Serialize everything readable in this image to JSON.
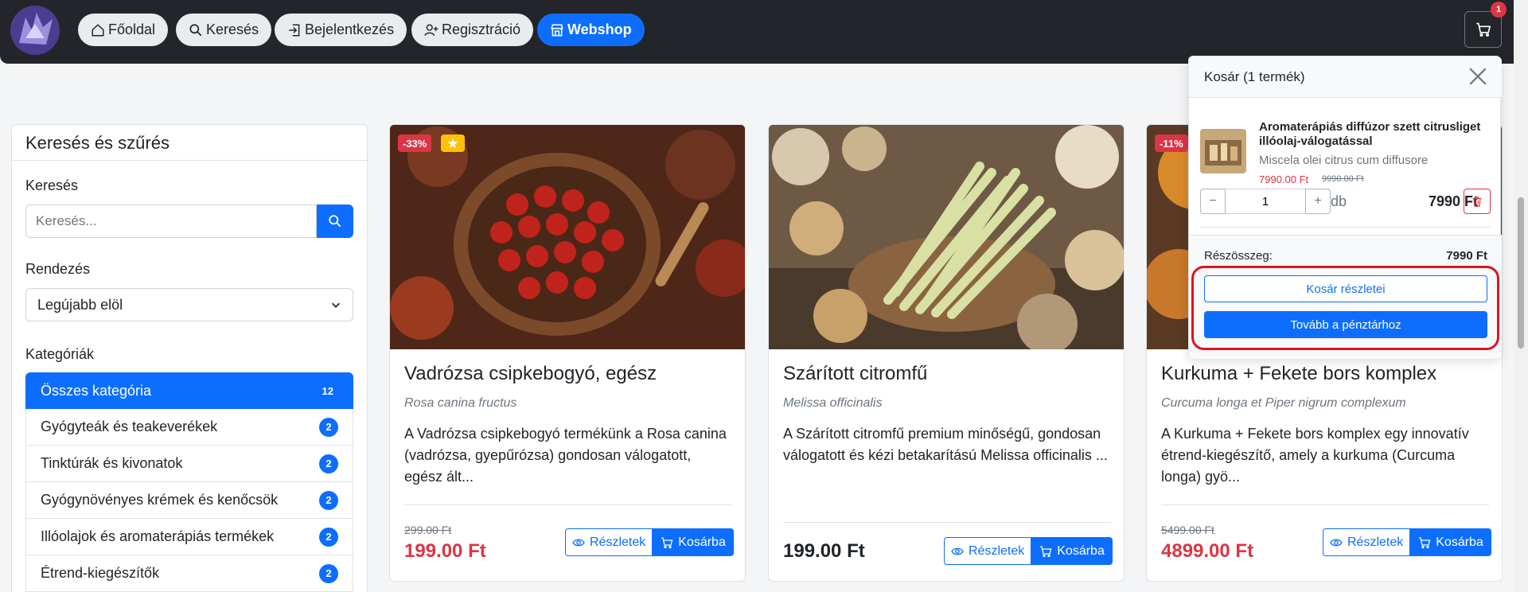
{
  "nav": {
    "items": [
      {
        "label": "Főoldal",
        "icon": "home-icon"
      },
      {
        "label": "Keresés",
        "icon": "search-icon"
      },
      {
        "label": "Bejelentkezés",
        "icon": "login-icon"
      },
      {
        "label": "Regisztráció",
        "icon": "user-plus-icon"
      },
      {
        "label": "Webshop",
        "icon": "shop-icon",
        "active": true
      }
    ],
    "cart_count": "1"
  },
  "sidebar": {
    "title": "Keresés és szűrés",
    "search_label": "Keresés",
    "search_placeholder": "Keresés...",
    "sort_label": "Rendezés",
    "sort_value": "Legújabb elöl",
    "categories_label": "Kategóriák",
    "categories": [
      {
        "label": "Összes kategória",
        "count": "12",
        "active": true
      },
      {
        "label": "Gyógyteák és teakeverékek",
        "count": "2"
      },
      {
        "label": "Tinktúrák és kivonatok",
        "count": "2"
      },
      {
        "label": "Gyógynövényes krémek és kenőcsök",
        "count": "2"
      },
      {
        "label": "Illóolajok és aromaterápiás termékek",
        "count": "2"
      },
      {
        "label": "Étrend-kiegészítők",
        "count": "2"
      }
    ]
  },
  "products": [
    {
      "discount": "-33%",
      "featured": true,
      "title": "Vadrózsa csipkebogyó, egész",
      "latin": "Rosa canina fructus",
      "desc": "A Vadrózsa csipkebogyó termékünk a Rosa canina (vadrózsa, gyepűrózsa) gondosan válogatott, egész ált...",
      "old_price": "299.00 Ft",
      "price": "199.00 Ft",
      "details_label": "Részletek",
      "cart_label": "Kosárba"
    },
    {
      "discount": "",
      "featured": false,
      "title": "Szárított citromfű",
      "latin": "Melissa officinalis",
      "desc": "A Szárított citromfű premium minőségű, gondosan válogatott és kézi betakarítású Melissa officinalis ...",
      "old_price": "",
      "price": "199.00 Ft",
      "details_label": "Részletek",
      "cart_label": "Kosárba"
    },
    {
      "discount": "-11%",
      "featured": false,
      "title": "Kurkuma + Fekete bors komplex",
      "latin": "Curcuma longa et Piper nigrum complexum",
      "desc": "A Kurkuma + Fekete bors komplex egy innovatív étrend-kiegészítő, amely a kurkuma (Curcuma longa) gyö...",
      "old_price": "5499.00 Ft",
      "price": "4899.00 Ft",
      "details_label": "Részletek",
      "cart_label": "Kosárba"
    }
  ],
  "cart": {
    "title": "Kosár (1 termék)",
    "item": {
      "name": "Aromaterápiás diffúzor szett citrusliget illóolaj-válogatással",
      "latin": "Miscela olei citrus cum diffusore",
      "price": "7990.00 Ft",
      "old_price": "9990.00 Ft",
      "qty": "1",
      "unit": "db",
      "line_total": "7990 Ft"
    },
    "subtotal_label": "Részösszeg:",
    "subtotal": "7990 Ft",
    "details_button": "Kosár részletei",
    "checkout_button": "Tovább a pénztárhoz"
  },
  "colors": {
    "primary": "#0d6efd",
    "danger": "#dc3545",
    "navbar": "#23252a",
    "highlight": "#e0141e"
  }
}
